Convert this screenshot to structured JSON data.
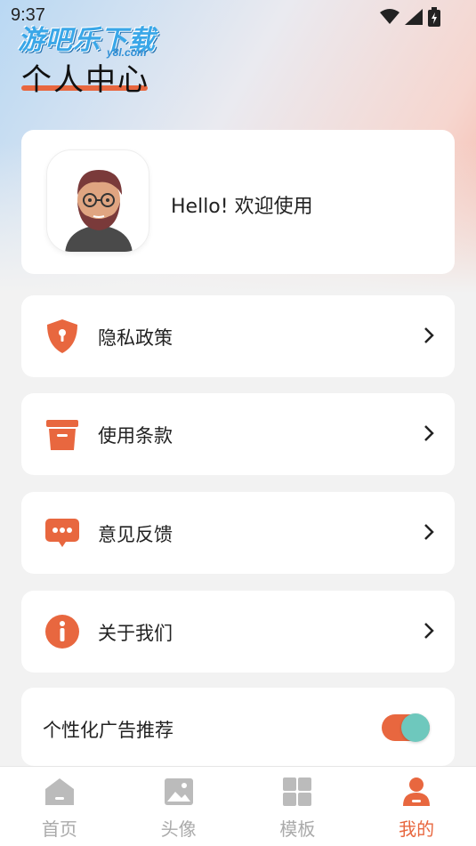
{
  "status_bar": {
    "time": "9:37"
  },
  "watermark": {
    "text": "游吧乐下载",
    "sub": "y8l.com"
  },
  "header": {
    "title": "个人中心"
  },
  "profile": {
    "greeting": "Hello! 欢迎使用",
    "avatar": "avatar-image"
  },
  "menu": [
    {
      "label": "隐私政策",
      "icon": "shield-icon"
    },
    {
      "label": "使用条款",
      "icon": "terms-box-icon"
    },
    {
      "label": "意见反馈",
      "icon": "chat-bubble-icon"
    },
    {
      "label": "关于我们",
      "icon": "info-icon"
    }
  ],
  "ad_setting": {
    "label": "个性化广告推荐",
    "enabled": true
  },
  "tabs": [
    {
      "label": "首页",
      "icon": "home-icon",
      "active": false
    },
    {
      "label": "头像",
      "icon": "image-icon",
      "active": false
    },
    {
      "label": "模板",
      "icon": "grid-icon",
      "active": false
    },
    {
      "label": "我的",
      "icon": "person-icon",
      "active": true
    }
  ],
  "colors": {
    "accent": "#e8673f",
    "inactive": "#aaaaaa",
    "toggle_knob": "#6ec8bd"
  }
}
